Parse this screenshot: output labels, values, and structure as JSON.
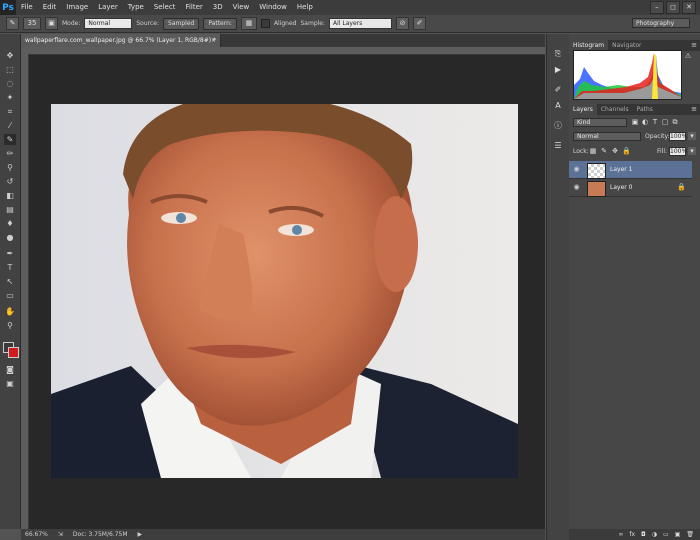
{
  "menubar": {
    "logo": "Ps",
    "items": [
      "File",
      "Edit",
      "Image",
      "Layer",
      "Type",
      "Select",
      "Filter",
      "3D",
      "View",
      "Window",
      "Help"
    ],
    "window_controls": [
      "–",
      "◻",
      "✕"
    ]
  },
  "options": {
    "brush_size": "35",
    "mode_label": "Mode:",
    "mode_value": "Normal",
    "source_label": "Source:",
    "sampled_button": "Sampled",
    "pattern_button": "Pattern:",
    "aligned_label": "Aligned",
    "sample_label": "Sample:",
    "sample_value": "All Layers",
    "workspace": "Photography"
  },
  "document": {
    "tab_title": "wallpaperflare.com_wallpaper.jpg @ 66.7% (Layer 1, RGB/8#) *",
    "tab_close": "×"
  },
  "status": {
    "zoom": "66.67%",
    "doc_info": "Doc: 3.75M/6.75M"
  },
  "panels": {
    "histogram_tabs": [
      "Histogram",
      "Navigator"
    ],
    "layers_tabs": [
      "Layers",
      "Channels",
      "Paths"
    ],
    "panel_menu_icon": "≡",
    "kind_label": "Kind",
    "blend_mode": "Normal",
    "opacity_label": "Opacity:",
    "opacity_value": "100%",
    "lock_label": "Lock:",
    "fill_label": "Fill:",
    "fill_value": "100%",
    "layers": [
      {
        "name": "Layer 1",
        "selected": true
      },
      {
        "name": "Layer 0",
        "selected": false
      }
    ],
    "footer_icons": [
      "link-icon",
      "fx-icon",
      "mask-icon",
      "adjustment-icon",
      "group-icon",
      "new-layer-icon",
      "trash-icon"
    ]
  },
  "colors": {
    "foreground": "#3a3a3a",
    "background": "#d01c1c",
    "selected_layer": "#5b7196",
    "canvas_bg": "#282828"
  }
}
